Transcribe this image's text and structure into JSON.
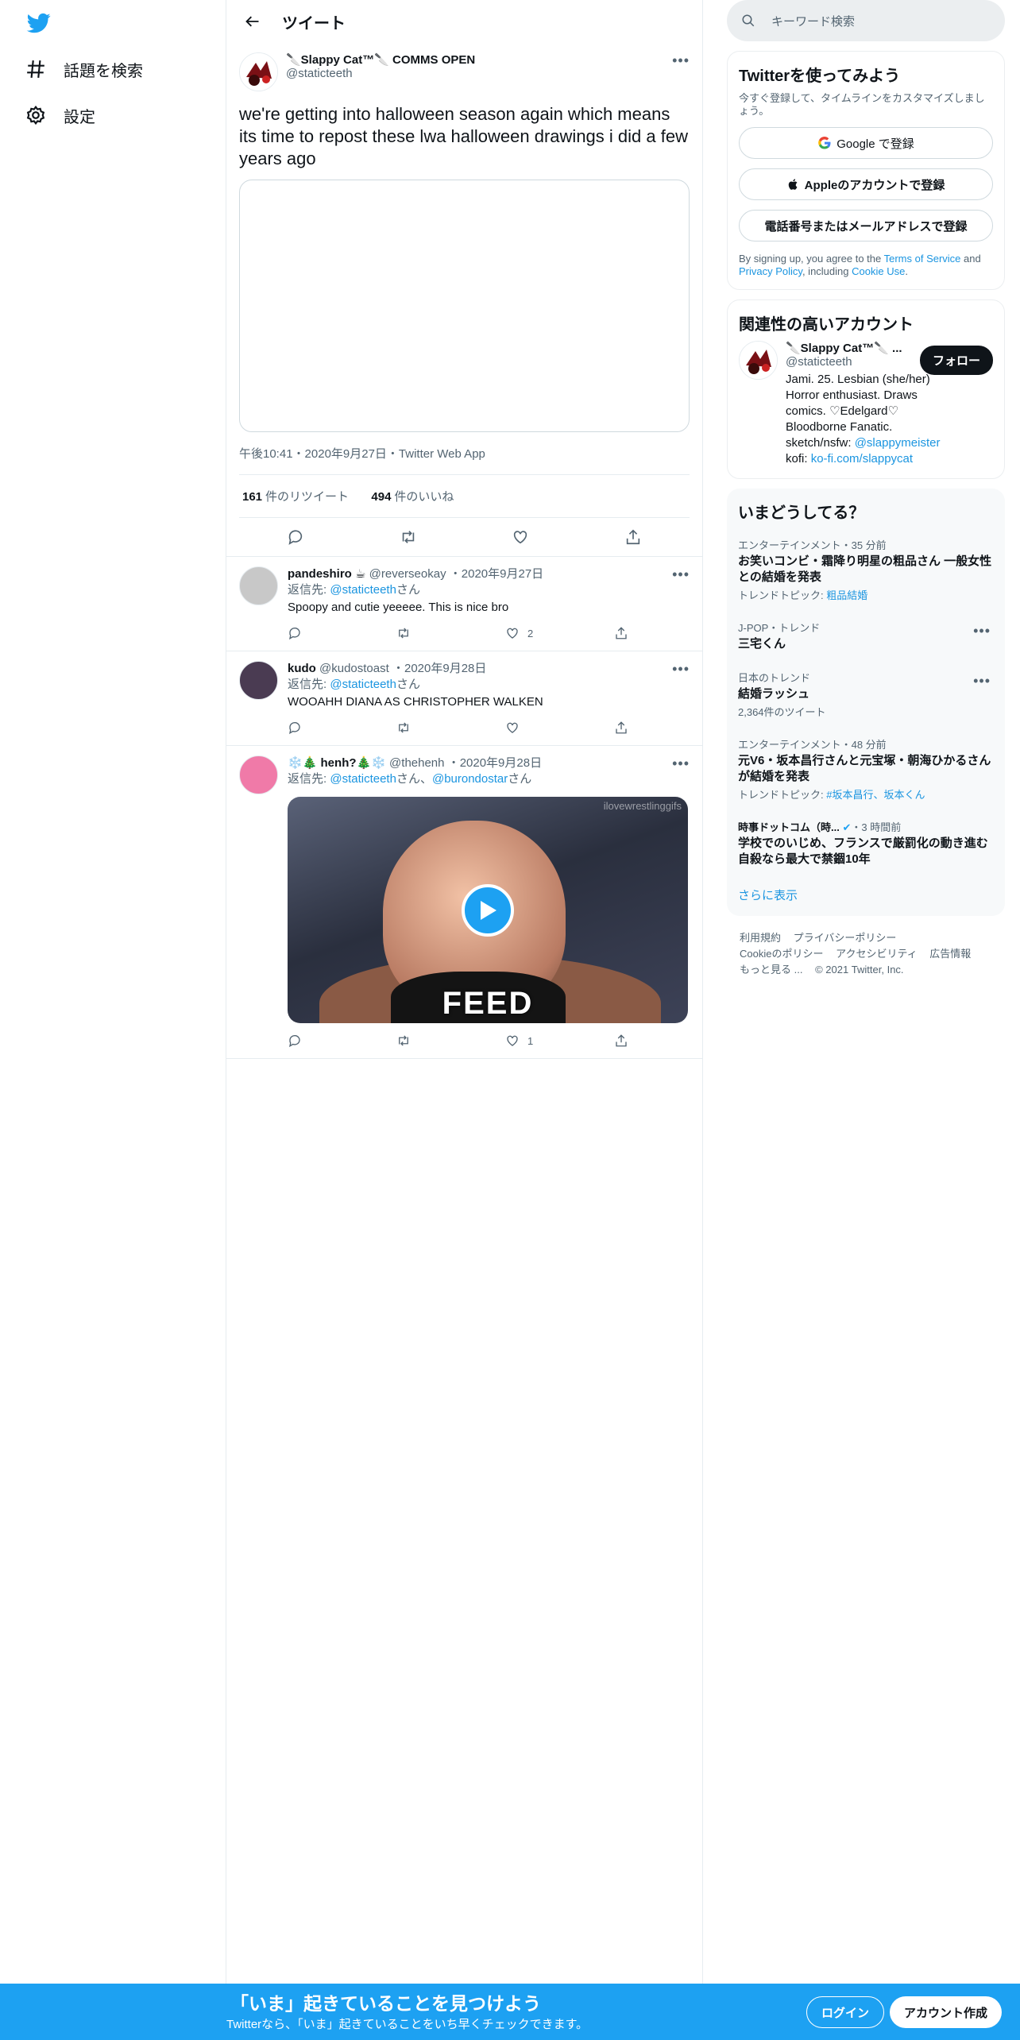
{
  "nav": {
    "explore_label": "話題を検索",
    "settings_label": "設定"
  },
  "header": {
    "title": "ツイート"
  },
  "tweet": {
    "author_name": "🔪Slappy Cat™🔪 COMMS OPEN",
    "author_handle": "@staticteeth",
    "text": "we're getting into halloween season again which means its time to repost these lwa halloween drawings i did a few years ago",
    "meta": "午後10:41・2020年9月27日・Twitter Web App",
    "retweets_count": "161",
    "retweets_label": "件のリツイート",
    "likes_count": "494",
    "likes_label": "件のいいね"
  },
  "replies": [
    {
      "name": "pandeshiro ☕",
      "handle": "@reverseokay",
      "date": "2020年9月27日",
      "reply_prefix": "返信先: ",
      "reply_to": "@staticteeth",
      "reply_suffix": "さん",
      "text": "Spoopy and cutie yeeeee. This is nice bro",
      "like_count": "2",
      "avatar_color": "#b5b5b5"
    },
    {
      "name": "kudo",
      "handle": "@kudostoast",
      "date": "2020年9月28日",
      "reply_prefix": "返信先: ",
      "reply_to": "@staticteeth",
      "reply_suffix": "さん",
      "text": "WOOAHH DIANA AS CHRISTOPHER WALKEN",
      "like_count": "",
      "avatar_color": "#4a3b52"
    },
    {
      "name": "❄️🎄 henh?🎄❄️",
      "handle": "@thehenh",
      "date": "2020年9月28日",
      "reply_prefix": "返信先: ",
      "reply_to": "@staticteeth",
      "reply_mid": "さん、",
      "reply_to2": "@burondostar",
      "reply_suffix": "さん",
      "gif_caption": "FEED",
      "gif_watermark": "ilovewrestlinggifs",
      "like_count": "1",
      "avatar_color": "#f07aa8"
    }
  ],
  "right": {
    "search_placeholder": "キーワード検索",
    "signup": {
      "title": "Twitterを使ってみよう",
      "subtitle": "今すぐ登録して、タイムラインをカスタマイズしましょう。",
      "google_label": "Google で登録",
      "apple_label": "Appleのアカウントで登録",
      "phone_label": "電話番号またはメールアドレスで登録",
      "terms_prefix": "By signing up, you agree to the ",
      "terms_link": "Terms of Service",
      "terms_and": " and ",
      "privacy_link": "Privacy Policy",
      "terms_including": ", including ",
      "cookie_link": "Cookie Use",
      "terms_end": "."
    },
    "related": {
      "title": "関連性の高いアカウント",
      "name": "🔪Slappy Cat™🔪 ...",
      "handle": "@staticteeth",
      "follow_label": "フォロー",
      "bio_text": "Jami. 25. Lesbian (she/her) Horror enthusiast. Draws comics. ♡Edelgard♡ Bloodborne Fanatic. sketch/nsfw: ",
      "bio_link1": "@slappymeister",
      "bio_mid": " kofi: ",
      "bio_link2": "ko-fi.com/slappycat"
    },
    "trends": {
      "title": "いまどうしてる？",
      "items": [
        {
          "context": "エンターテインメント・35 分前",
          "title": "お笑いコンビ・霜降り明星の粗品さん 一般女性との結婚を発表",
          "topic_prefix": "トレンドトピック: ",
          "topic": "粗品結婚"
        },
        {
          "context": "J-POP・トレンド",
          "title": "三宅くん"
        },
        {
          "context": "日本のトレンド",
          "title": "結婚ラッシュ",
          "count": "2,364件のツイート"
        },
        {
          "context": "エンターテインメント・48 分前",
          "title": "元V6・坂本昌行さんと元宝塚・朝海ひかるさんが結婚を発表",
          "topic_prefix": "トレンドトピック: ",
          "topic": "#坂本昌行、坂本くん"
        },
        {
          "context": "時事ドットコム（時...",
          "context_time": "・3 時間前",
          "title": "学校でのいじめ、フランスで厳罰化の動き進む　自殺なら最大で禁錮10年"
        }
      ],
      "show_more": "さらに表示"
    },
    "footer": {
      "links": [
        "利用規約",
        "プライバシーポリシー",
        "Cookieのポリシー",
        "アクセシビリティ",
        "広告情報",
        "もっと見る ..."
      ],
      "copyright": "© 2021 Twitter, Inc."
    }
  },
  "bottom": {
    "title": "「いま」起きていることを見つけよう",
    "subtitle": "Twitterなら、「いま」起きていることをいち早くチェックできます。",
    "login": "ログイン",
    "signup": "アカウント作成"
  },
  "colors": {
    "accent": "#1da1f2",
    "link": "#1b95e0"
  }
}
